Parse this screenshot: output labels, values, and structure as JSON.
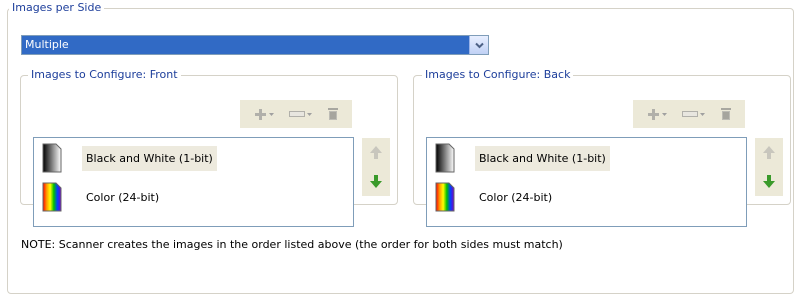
{
  "images_per_side": {
    "legend": "Images per Side",
    "selected": "Multiple"
  },
  "front": {
    "legend": "Images to Configure: Front",
    "items": [
      {
        "label": "Black and White (1-bit)",
        "icon": "bw-image-icon"
      },
      {
        "label": "Color (24-bit)",
        "icon": "color-image-icon"
      }
    ]
  },
  "back": {
    "legend": "Images to Configure: Back",
    "items": [
      {
        "label": "Black and White (1-bit)",
        "icon": "bw-image-icon"
      },
      {
        "label": "Color (24-bit)",
        "icon": "color-image-icon"
      }
    ]
  },
  "note": "NOTE: Scanner creates the images in the order listed above (the order for both sides must match)",
  "colors": {
    "legend_text": "#1d3e9b",
    "selection": "#316ac5",
    "panel": "#ece9d8",
    "up_arrow_disabled": "#c8c6bd",
    "down_arrow": "#3a9a2a"
  }
}
